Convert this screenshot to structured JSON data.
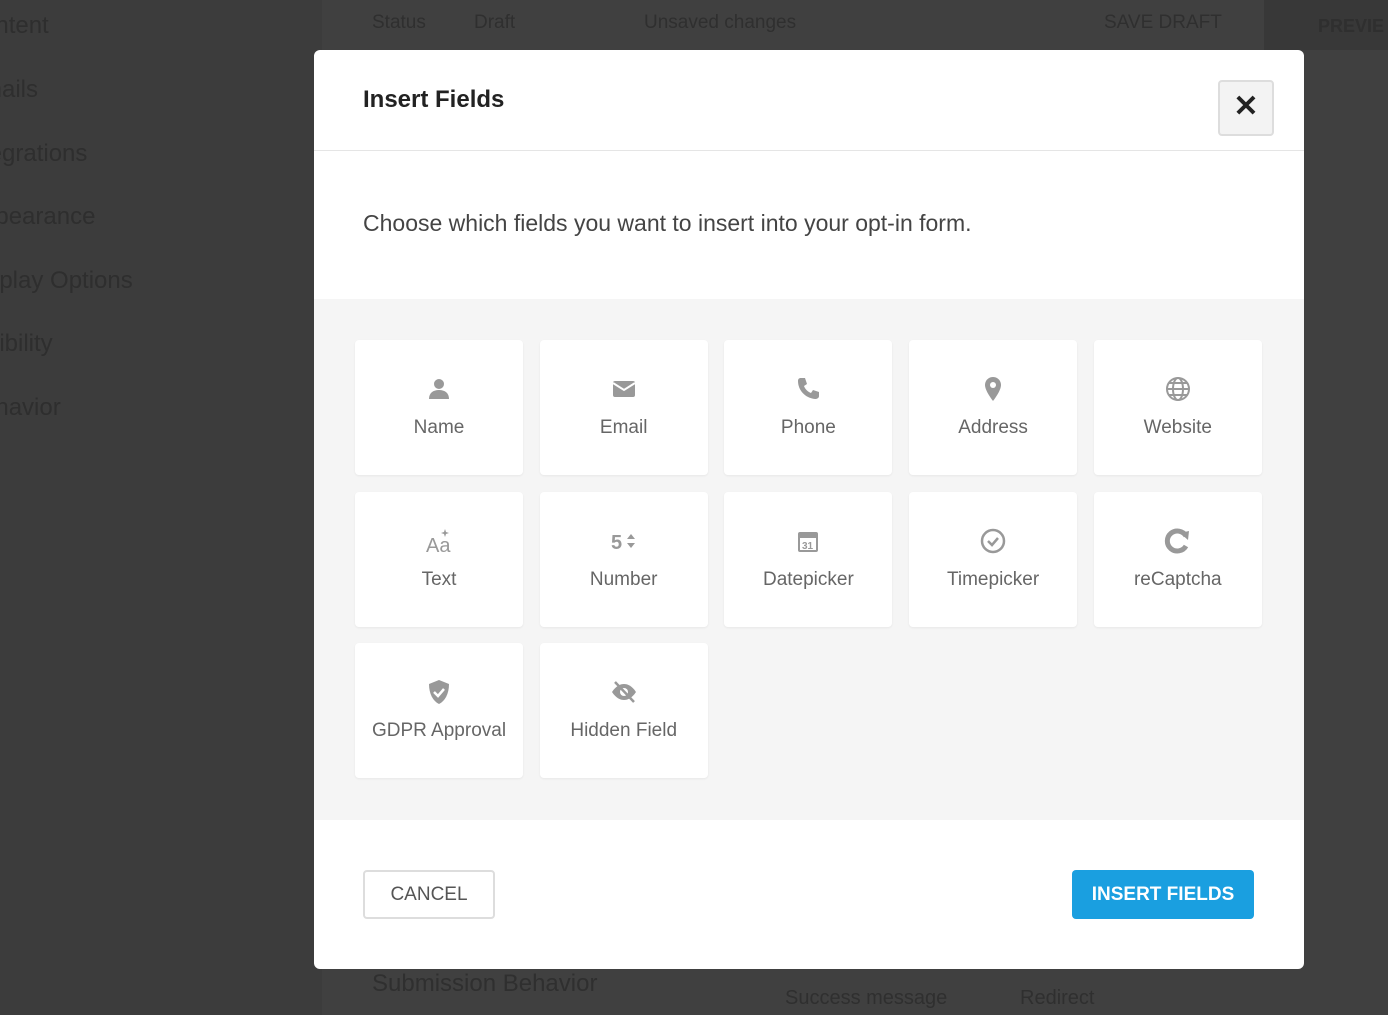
{
  "background": {
    "sidebar": [
      "ontent",
      "mails",
      "tegrations",
      "ppearance",
      "isplay Options",
      "isibility",
      "ehavior"
    ],
    "topbar": {
      "status": "Status",
      "draft": "Draft",
      "unsaved": "Unsaved changes",
      "save_draft": "SAVE DRAFT",
      "preview": "PREVIE"
    },
    "submission_behavior": "Submission Behavior",
    "success_message": "Success message",
    "redirect": "Redirect"
  },
  "modal": {
    "title": "Insert Fields",
    "description": "Choose which fields you want to insert into your opt-in form.",
    "fields": [
      {
        "label": "Name",
        "icon": "user-icon"
      },
      {
        "label": "Email",
        "icon": "envelope-icon"
      },
      {
        "label": "Phone",
        "icon": "phone-icon"
      },
      {
        "label": "Address",
        "icon": "map-pin-icon"
      },
      {
        "label": "Website",
        "icon": "globe-icon"
      },
      {
        "label": "Text",
        "icon": "text-icon"
      },
      {
        "label": "Number",
        "icon": "number-icon"
      },
      {
        "label": "Datepicker",
        "icon": "calendar-icon"
      },
      {
        "label": "Timepicker",
        "icon": "clock-icon"
      },
      {
        "label": "reCaptcha",
        "icon": "recaptcha-icon"
      },
      {
        "label": "GDPR Approval",
        "icon": "shield-check-icon"
      },
      {
        "label": "Hidden Field",
        "icon": "eye-slash-icon"
      }
    ],
    "cancel_label": "CANCEL",
    "insert_label": "INSERT FIELDS",
    "accent": "#1a9fe0"
  }
}
